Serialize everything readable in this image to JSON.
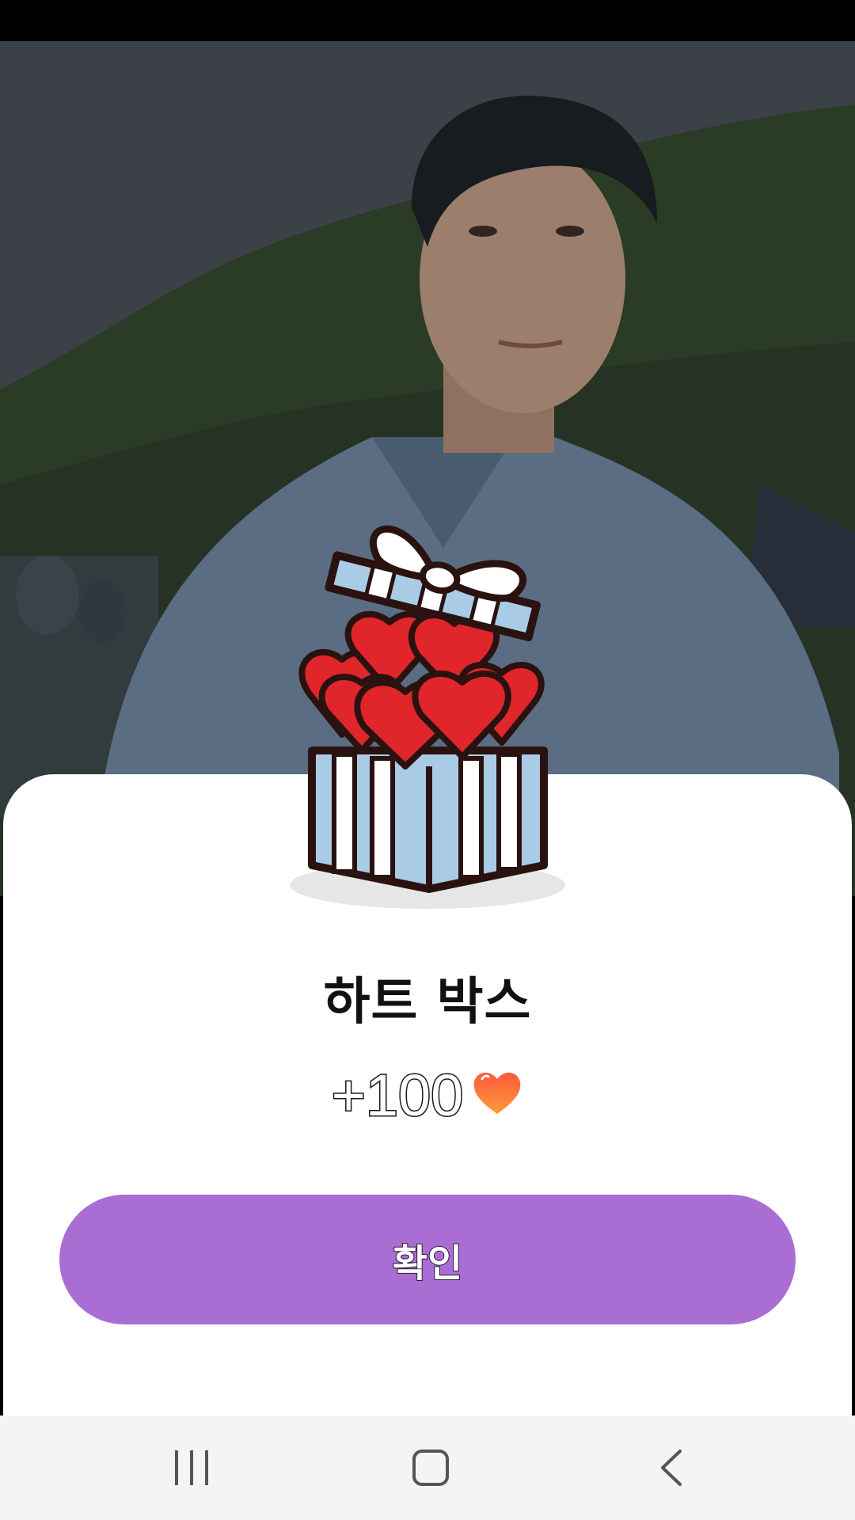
{
  "popup": {
    "title": "하트 박스",
    "reward_text": "+100",
    "confirm_label": "확인"
  },
  "icons": {
    "gift": "gift-box-hearts-icon",
    "reward": "heart-icon",
    "recents": "recent-apps-icon",
    "home": "home-icon",
    "back": "back-icon"
  },
  "colors": {
    "accent": "#a96dd4",
    "heart": "#e0262a",
    "box_blue": "#a9cbe6"
  }
}
